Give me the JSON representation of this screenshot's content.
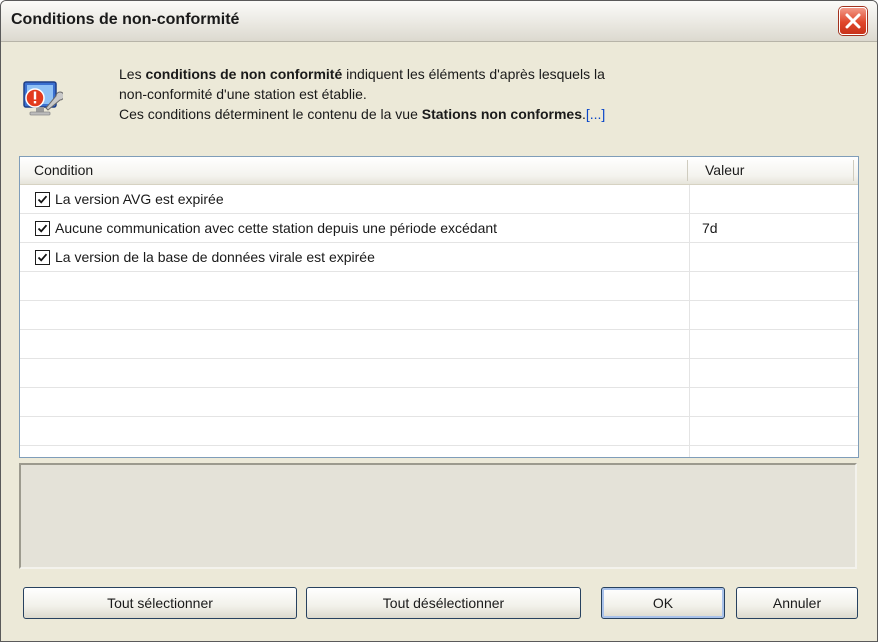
{
  "window": {
    "title": "Conditions de non-conformité"
  },
  "header": {
    "line1_pre": "Les ",
    "line1_bold": "conditions de non conformité",
    "line1_post": " indiquent les éléments d'après lesquels la",
    "line2": "non-conformité d'une station est établie.",
    "line3_pre": "Ces conditions déterminent le contenu de la vue ",
    "line3_bold": "Stations non conformes",
    "line3_post": ".",
    "more_link": "[...]",
    "icon": "monitor-warning-wrench-icon"
  },
  "table": {
    "columns": [
      "Condition",
      "Valeur"
    ],
    "rows": [
      {
        "checked": true,
        "condition": "La version AVG est expirée",
        "value": ""
      },
      {
        "checked": true,
        "condition": "Aucune communication avec cette station depuis une période excédant",
        "value": "7d"
      },
      {
        "checked": true,
        "condition": "La version de la base de données virale est expirée",
        "value": ""
      }
    ]
  },
  "buttons": {
    "select_all": "Tout sélectionner",
    "deselect_all": "Tout désélectionner",
    "ok": "OK",
    "cancel": "Annuler"
  },
  "colors": {
    "close_button": "#e0472b",
    "link": "#0a46c8",
    "dialog_bg": "#ece9d8"
  }
}
